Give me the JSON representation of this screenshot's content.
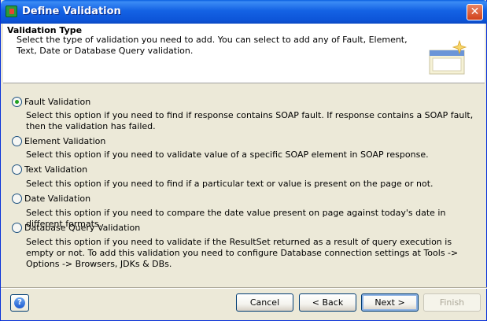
{
  "window": {
    "title": "Define Validation",
    "close_glyph": "✕"
  },
  "header": {
    "title": "Validation Type",
    "description": "Select the type of validation you need to add. You can select to add any of Fault, Element, Text, Date or Database Query validation.",
    "image_icon": "wizard-window-sparkle-icon"
  },
  "options": [
    {
      "label": "Fault Validation",
      "selected": true,
      "description": "Select this option if you need to find if response contains SOAP fault. If response contains a SOAP fault, then the validation has failed."
    },
    {
      "label": "Element Validation",
      "selected": false,
      "description": "Select this option if you need to validate value of a specific SOAP element in SOAP response."
    },
    {
      "label": "Text Validation",
      "selected": false,
      "description": "Select this option if you need to find if a particular text or value is present on the page or not."
    },
    {
      "label": "Date Validation",
      "selected": false,
      "description": "Select this option if you need to compare the date value present on page against today's date in different formats."
    },
    {
      "label": "Database Query Validation",
      "selected": false,
      "description": "Select this option if you need to validate if the ResultSet returned as a result of query execution is empty or not. To add this validation you need to configure Database connection settings at Tools -> Options -> Browsers, JDKs & DBs."
    }
  ],
  "footer": {
    "help_icon": "help-question-icon",
    "help_glyph": "?",
    "cancel_label": "Cancel",
    "back_label": "< Back",
    "next_label": "Next >",
    "finish_label": "Finish"
  }
}
